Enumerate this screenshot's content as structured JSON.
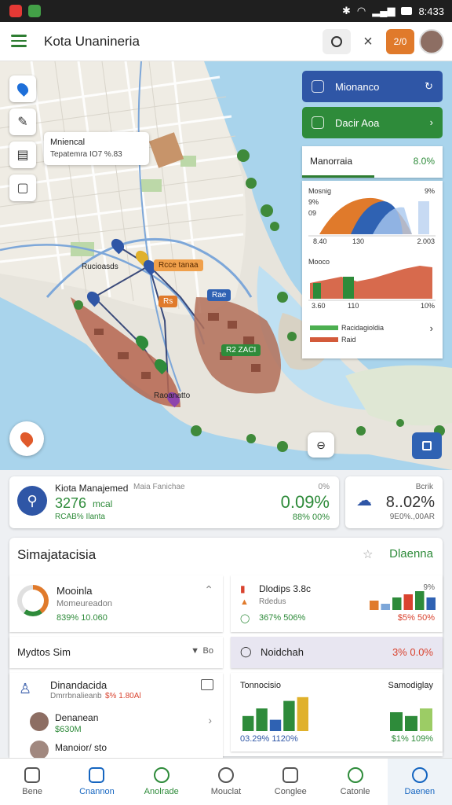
{
  "status": {
    "time": "8:433"
  },
  "app": {
    "title": "Kota Unanineria",
    "badge": "2/0"
  },
  "map": {
    "info_card": {
      "line1": "Mniencal",
      "line2": "Tepatemra IO7 %.83"
    },
    "panel_top": {
      "label": "Mionanco"
    },
    "panel_second": {
      "label": "Dacir Aoa"
    },
    "kpi": {
      "label": "Manorraia",
      "value": "8.0%"
    },
    "chart_panel": {
      "top_title": "Mosnig",
      "top_pct": "9%",
      "y_top": "9%",
      "y_mid": "09",
      "x_left": "8.40",
      "x_mid": "130",
      "x_right": "2.003",
      "mid_title": "Mooco",
      "mid_x_left": "3.60",
      "mid_x_mid": "110",
      "mid_x_right": "10%",
      "legend_1": "Racidagioldia",
      "legend_2": "Raid"
    },
    "labels": {
      "marker_orange": "Rcce tanaa",
      "marker_orange2": "Rs",
      "marker_blue": "Rae",
      "marker_green": "R2 ZACI",
      "place1": "Rucioasds",
      "place2": "Raoanatto"
    }
  },
  "summary": {
    "title": "Kiota Manajemed",
    "subtitle": "Maia Fanichae",
    "value": "3276",
    "unit": "mcal",
    "sub": "RCAB% Ilanta",
    "pct_top": "0%",
    "pct": "0.09%",
    "pct_sub": "88% 00%"
  },
  "side_summary": {
    "label": "Bcrik",
    "value": "8..02%",
    "sub": "9E0%.,00AR"
  },
  "section": {
    "title": "Simajatacisia",
    "link": "Dlaenna"
  },
  "list_card": {
    "item1_title": "Mooinla",
    "item1_sub": "Momeureadon",
    "item1_values": "839% 10.060",
    "select_label": "Mydtos Sim",
    "select_value": "Bo",
    "item2_title": "Dinandacida",
    "item2_sub": "Dmrrbnalieanb",
    "item2_red": "$% 1.80Al",
    "person1_name": "Denanean",
    "person1_value": "$630M",
    "person2_name": "Manoior/ sto"
  },
  "right_card1": {
    "title": "Dlodips 3.8c",
    "pct": "9%",
    "sub": "Rdedus",
    "values": "367% 506%",
    "red": "$5% 50%"
  },
  "right_band": {
    "label": "Noidchah",
    "value": "3% 0.0%"
  },
  "right_card2": {
    "left_title": "Tonnocisio",
    "right_title": "Samodiglay",
    "left_values": "03.29% 1120%",
    "right_values": "$1% 109%"
  },
  "chart_data": [
    {
      "type": "bar",
      "categories": [
        "1",
        "2",
        "3",
        "4",
        "5",
        "6"
      ],
      "values": [
        3,
        2,
        4,
        5,
        6,
        4
      ]
    },
    {
      "type": "bar",
      "categories": [
        "1",
        "2",
        "3",
        "4",
        "5",
        "6",
        "7",
        "8"
      ],
      "values": [
        4,
        6,
        3,
        8,
        9,
        5,
        4,
        6
      ]
    }
  ],
  "nav": [
    {
      "label": "Bene"
    },
    {
      "label": "Cnannon"
    },
    {
      "label": "Anolrade"
    },
    {
      "label": "Mouclat"
    },
    {
      "label": "Conglee"
    },
    {
      "label": "Catonle"
    },
    {
      "label": "Daenen"
    }
  ],
  "colors": {
    "green": "#2e8b3a",
    "blue": "#2f62b3",
    "orange": "#e07a2b",
    "red": "#d9432f"
  }
}
